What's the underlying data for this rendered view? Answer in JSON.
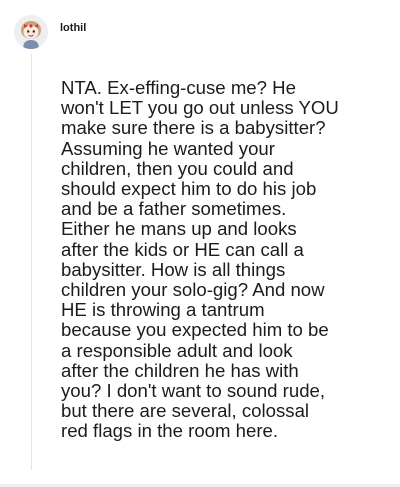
{
  "comment": {
    "username": "lothil",
    "avatar_icon": "snoo-avatar-icon",
    "body": "NTA. Ex-effing-cuse me? He\nwon't LET you go out unless YOU\nmake sure there is a babysitter?\nAssuming he wanted your\nchildren, then you could and\nshould expect him to do his job\nand be a father sometimes.\nEither he mans up and looks\nafter the kids or HE can call a\nbabysitter. How is all things\nchildren your solo-gig? And now\nHE is throwing a tantrum\nbecause you expected him to be\na responsible adult and look\nafter the children he has with\nyou? I don't want to sound rude,\nbut there are several, colossal\nred flags in the room here."
  },
  "colors": {
    "text": "#1c1c1c",
    "thread_line": "#e3e3e3",
    "background": "#ffffff"
  }
}
